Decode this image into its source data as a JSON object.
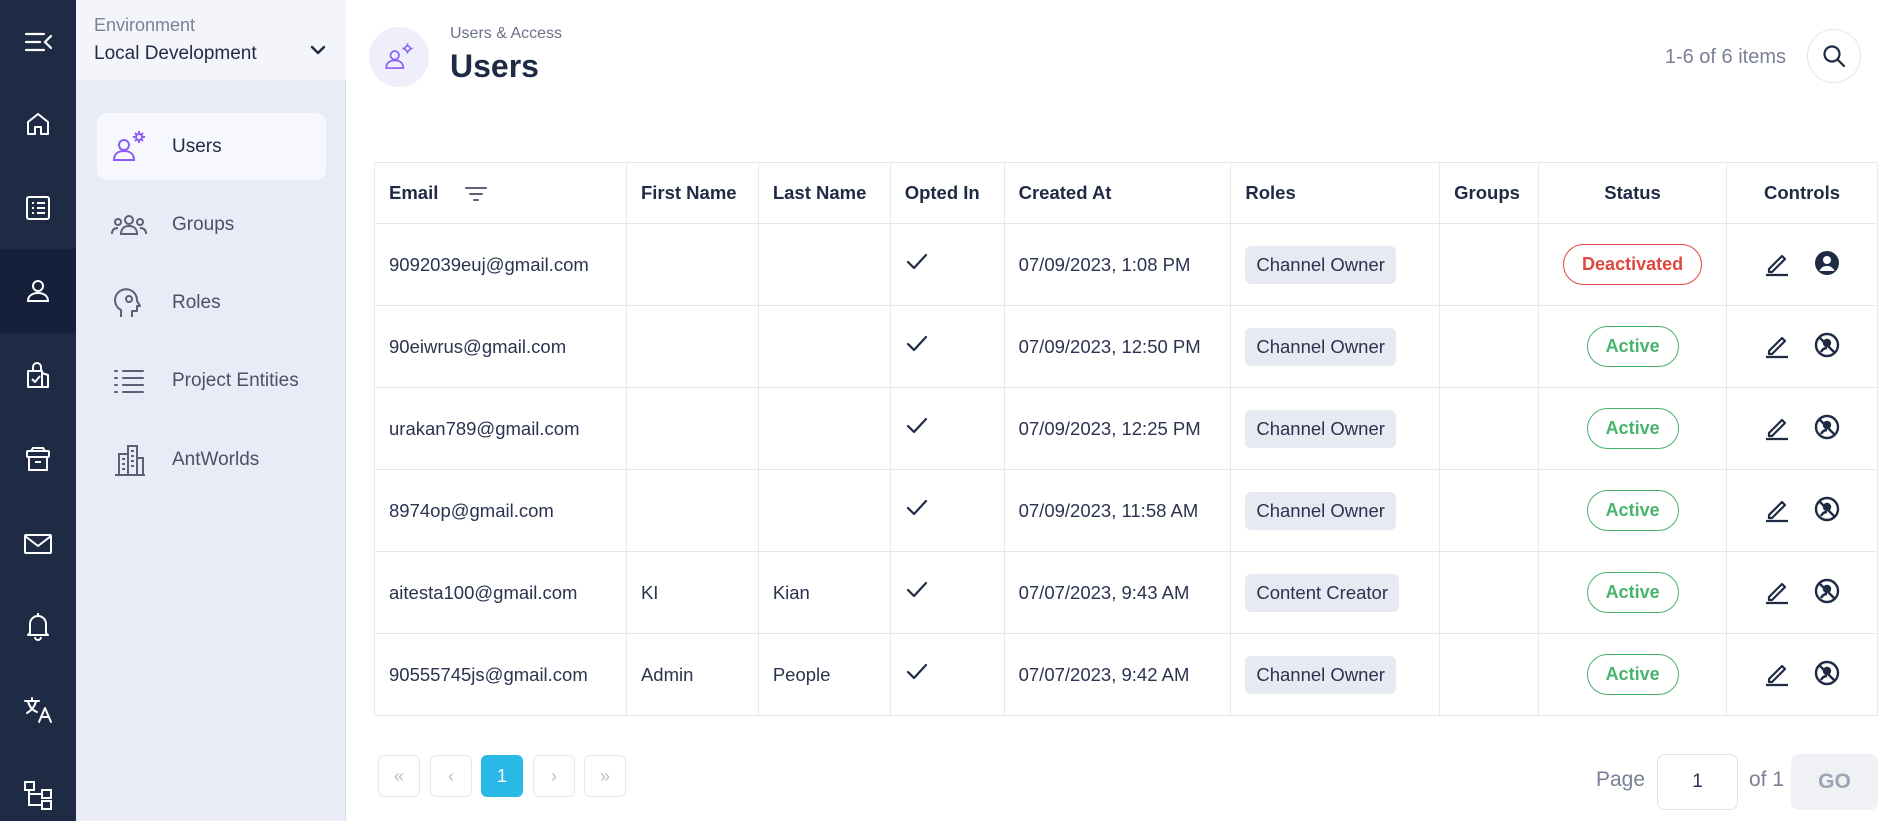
{
  "rail": {
    "items": [
      {
        "icon": "menu-collapse-icon"
      },
      {
        "icon": "home-icon"
      },
      {
        "icon": "list-icon"
      },
      {
        "icon": "user-icon",
        "active": true
      },
      {
        "icon": "bag-check-icon"
      },
      {
        "icon": "archive-icon"
      },
      {
        "icon": "mail-icon"
      },
      {
        "icon": "bell-icon"
      },
      {
        "icon": "translate-icon"
      },
      {
        "icon": "hierarchy-icon"
      }
    ]
  },
  "environment": {
    "label": "Environment",
    "value": "Local Development"
  },
  "sidebar": {
    "items": [
      {
        "label": "Users",
        "icon": "users-gear-icon",
        "active": true
      },
      {
        "label": "Groups",
        "icon": "group-icon"
      },
      {
        "label": "Roles",
        "icon": "head-gear-icon"
      },
      {
        "label": "Project Entities",
        "icon": "list-bullets-icon"
      },
      {
        "label": "AntWorlds",
        "icon": "buildings-icon"
      }
    ]
  },
  "header": {
    "breadcrumb": "Users & Access",
    "title": "Users",
    "count": "1-6 of 6 items"
  },
  "table": {
    "columns": [
      "Email",
      "First Name",
      "Last Name",
      "Opted In",
      "Created At",
      "Roles",
      "Groups",
      "Status",
      "Controls"
    ],
    "rows": [
      {
        "email": "9092039euj@gmail.com",
        "first": "",
        "last": "",
        "opted": true,
        "created": "07/09/2023, 1:08 PM",
        "role": "Channel Owner",
        "groups": "",
        "status": "Deactivated"
      },
      {
        "email": "90eiwrus@gmail.com",
        "first": "",
        "last": "",
        "opted": true,
        "created": "07/09/2023, 12:50 PM",
        "role": "Channel Owner",
        "groups": "",
        "status": "Active"
      },
      {
        "email": "urakan789@gmail.com",
        "first": "",
        "last": "",
        "opted": true,
        "created": "07/09/2023, 12:25 PM",
        "role": "Channel Owner",
        "groups": "",
        "status": "Active"
      },
      {
        "email": "8974op@gmail.com",
        "first": "",
        "last": "",
        "opted": true,
        "created": "07/09/2023, 11:58 AM",
        "role": "Channel Owner",
        "groups": "",
        "status": "Active"
      },
      {
        "email": "aitesta100@gmail.com",
        "first": "KI",
        "last": "Kian",
        "opted": true,
        "created": "07/07/2023, 9:43 AM",
        "role": "Content Creator",
        "groups": "",
        "status": "Active"
      },
      {
        "email": "90555745js@gmail.com",
        "first": "Admin",
        "last": "People",
        "opted": true,
        "created": "07/07/2023, 9:42 AM",
        "role": "Channel Owner",
        "groups": "",
        "status": "Active"
      }
    ]
  },
  "pagination": {
    "first": "«",
    "prev": "‹",
    "current": "1",
    "next": "›",
    "last": "»",
    "page_label": "Page",
    "page_value": "1",
    "of_label": "of 1",
    "go_label": "GO"
  },
  "colors": {
    "rail_bg": "#1f2a44",
    "panel_bg": "#e9ecf7",
    "active_green": "#47b36b",
    "deactivated_red": "#e0483f",
    "page_current": "#2ab8e6"
  }
}
